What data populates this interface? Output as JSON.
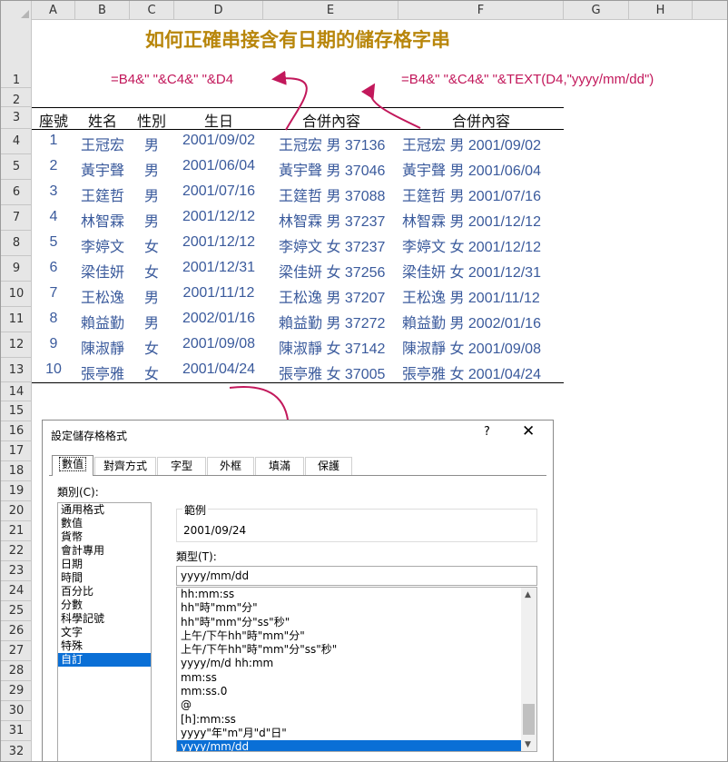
{
  "title": "如何正確串接含有日期的儲存格字串",
  "columns": [
    "A",
    "B",
    "C",
    "D",
    "E",
    "F",
    "G",
    "H"
  ],
  "rows": [
    "1",
    "2",
    "3",
    "4",
    "5",
    "6",
    "7",
    "8",
    "9",
    "10",
    "11",
    "12",
    "13",
    "14",
    "15",
    "16",
    "17",
    "18",
    "19",
    "20",
    "21",
    "22",
    "23",
    "24",
    "25",
    "26",
    "27",
    "28",
    "29",
    "30",
    "31",
    "32"
  ],
  "formula_left": "=B4&\" \"&C4&\" \"&D4",
  "formula_right": "=B4&\" \"&C4&\" \"&TEXT(D4,\"yyyy/mm/dd\")",
  "headers": [
    "座號",
    "姓名",
    "性別",
    "生日",
    "合併內容",
    "合併內容"
  ],
  "data": [
    [
      "1",
      "王冠宏",
      "男",
      "2001/09/02",
      "王冠宏 男 37136",
      "王冠宏 男 2001/09/02"
    ],
    [
      "2",
      "黃宇聲",
      "男",
      "2001/06/04",
      "黃宇聲 男 37046",
      "黃宇聲 男 2001/06/04"
    ],
    [
      "3",
      "王筳哲",
      "男",
      "2001/07/16",
      "王筳哲 男 37088",
      "王筳哲 男 2001/07/16"
    ],
    [
      "4",
      "林智霖",
      "男",
      "2001/12/12",
      "林智霖 男 37237",
      "林智霖 男 2001/12/12"
    ],
    [
      "5",
      "李婷文",
      "女",
      "2001/12/12",
      "李婷文 女 37237",
      "李婷文 女 2001/12/12"
    ],
    [
      "6",
      "梁佳妍",
      "女",
      "2001/12/31",
      "梁佳妍 女 37256",
      "梁佳妍 女 2001/12/31"
    ],
    [
      "7",
      "王松逸",
      "男",
      "2001/11/12",
      "王松逸 男 37207",
      "王松逸 男 2001/11/12"
    ],
    [
      "8",
      "賴益勤",
      "男",
      "2002/01/16",
      "賴益勤 男 37272",
      "賴益勤 男 2002/01/16"
    ],
    [
      "9",
      "陳淑靜",
      "女",
      "2001/09/08",
      "陳淑靜 女 37142",
      "陳淑靜 女 2001/09/08"
    ],
    [
      "10",
      "張亭雅",
      "女",
      "2001/04/24",
      "張亭雅 女 37005",
      "張亭雅 女 2001/04/24"
    ]
  ],
  "colors": {
    "title": "#b8860b",
    "formula": "#c2185b",
    "data_text": "#3a5a9c",
    "selection": "#0a6fd6"
  },
  "dialog": {
    "title": "設定儲存格格式",
    "help": "?",
    "close": "✕",
    "tabs": [
      "數值",
      "對齊方式",
      "字型",
      "外框",
      "填滿",
      "保護"
    ],
    "category_label": "類別(C):",
    "categories": [
      "通用格式",
      "數值",
      "貨幣",
      "會計專用",
      "日期",
      "時間",
      "百分比",
      "分數",
      "科學記號",
      "文字",
      "特殊",
      "自訂"
    ],
    "selected_category": "自訂",
    "sample_label": "範例",
    "sample_value": "2001/09/24",
    "type_label": "類型(T):",
    "type_value": "yyyy/mm/dd",
    "type_list": [
      "hh:mm:ss",
      "hh\"時\"mm\"分\"",
      "hh\"時\"mm\"分\"ss\"秒\"",
      "上午/下午hh\"時\"mm\"分\"",
      "上午/下午hh\"時\"mm\"分\"ss\"秒\"",
      "yyyy/m/d hh:mm",
      "mm:ss",
      "mm:ss.0",
      "@",
      "[h]:mm:ss",
      "yyyy\"年\"m\"月\"d\"日\"",
      "yyyy/mm/dd"
    ],
    "selected_type": "yyyy/mm/dd"
  }
}
